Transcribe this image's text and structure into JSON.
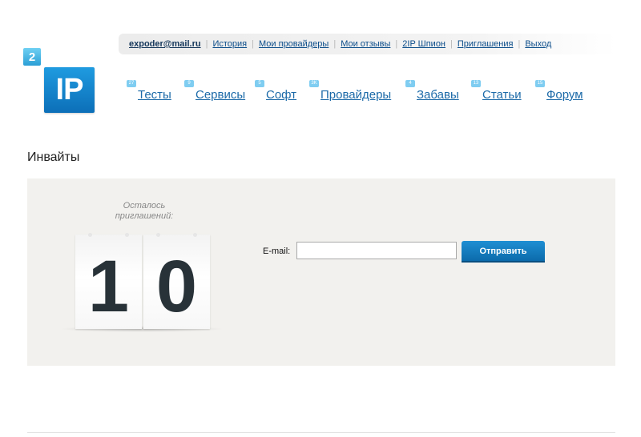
{
  "logo": {
    "small": "2",
    "big": "IP"
  },
  "userbar": {
    "email": "expoder@mail.ru",
    "links": [
      "История",
      "Мои провайдеры",
      "Мои отзывы",
      "2IP Шпион",
      "Приглашения",
      "Выход"
    ]
  },
  "nav": [
    {
      "label": "Тесты",
      "badge": "27"
    },
    {
      "label": "Сервисы",
      "badge": "9"
    },
    {
      "label": "Софт",
      "badge": "5"
    },
    {
      "label": "Провайдеры",
      "badge": "3K"
    },
    {
      "label": "Забавы",
      "badge": "4"
    },
    {
      "label": "Статьи",
      "badge": "13"
    },
    {
      "label": "Форум",
      "badge": "15"
    }
  ],
  "page_title": "Инвайты",
  "invites": {
    "remaining_label": "Осталось приглашений:",
    "remaining_digits": [
      "1",
      "0"
    ],
    "email_label": "E-mail:",
    "email_value": "",
    "send_label": "Отправить"
  },
  "colors": {
    "accent": "#1c6aa8",
    "button": "#0c6bab",
    "panel": "#f2f1ee"
  }
}
